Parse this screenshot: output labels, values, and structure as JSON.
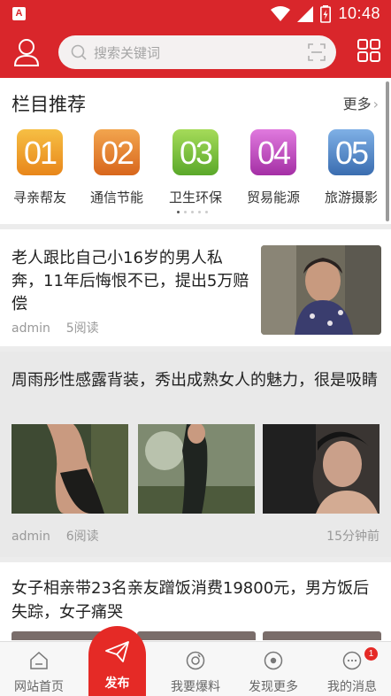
{
  "status_bar": {
    "time": "10:48",
    "notification_glyph": "A"
  },
  "header": {
    "search_placeholder": "搜索关键词",
    "icons": [
      "user-icon",
      "search-icon",
      "scan-icon",
      "grid-icon"
    ]
  },
  "categories": {
    "title": "栏目推荐",
    "more_label": "更多",
    "items": [
      {
        "num": "01",
        "label": "寻亲帮友",
        "color": "#f0a21f"
      },
      {
        "num": "02",
        "label": "通信节能",
        "color": "#e58a2e"
      },
      {
        "num": "03",
        "label": "卫生环保",
        "color": "#7cc23d"
      },
      {
        "num": "04",
        "label": "贸易能源",
        "color": "#c24bbf"
      },
      {
        "num": "05",
        "label": "旅游摄影",
        "color": "#4e86c4"
      }
    ]
  },
  "articles": [
    {
      "title": "老人跟比自己小16岁的男人私奔，11年后悔恨不已，提出5万赔偿",
      "author": "admin",
      "reads": "5阅读"
    },
    {
      "title": "周雨彤性感露背装，秀出成熟女人的魅力，很是吸睛",
      "author": "admin",
      "reads": "6阅读",
      "time": "15分钟前"
    },
    {
      "title": "女子相亲带23名亲友蹭饭消费19800元，男方饭后失踪，女子痛哭"
    }
  ],
  "bottom_nav": {
    "items": [
      {
        "label": "网站首页",
        "icon": "home-icon"
      },
      {
        "label": "发布",
        "icon": "paper-plane-icon"
      },
      {
        "label": "我要爆料",
        "icon": "camera-icon"
      },
      {
        "label": "发现更多",
        "icon": "compass-icon"
      },
      {
        "label": "我的消息",
        "icon": "message-icon"
      }
    ],
    "message_badge": "1"
  },
  "colors": {
    "brand_red": "#d9262b",
    "publish_red": "#e52a26"
  }
}
